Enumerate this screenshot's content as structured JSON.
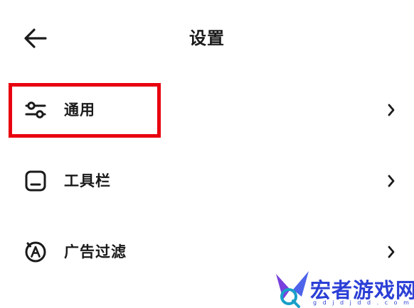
{
  "header": {
    "title": "设置",
    "back_icon": "arrow-left-icon"
  },
  "rows": [
    {
      "label": "通用",
      "icon": "sliders-icon"
    },
    {
      "label": "工具栏",
      "icon": "toolbar-icon"
    },
    {
      "label": "广告过滤",
      "icon": "ad-block-icon"
    }
  ],
  "highlight": {
    "target": "通用",
    "color": "#e8000f"
  },
  "watermark": {
    "text": "宏者游戏网",
    "url": "g d j d j d d . c o m",
    "color": "#2b3fd6"
  },
  "colors": {
    "text": "#1a1a1a",
    "background": "#ffffff"
  }
}
